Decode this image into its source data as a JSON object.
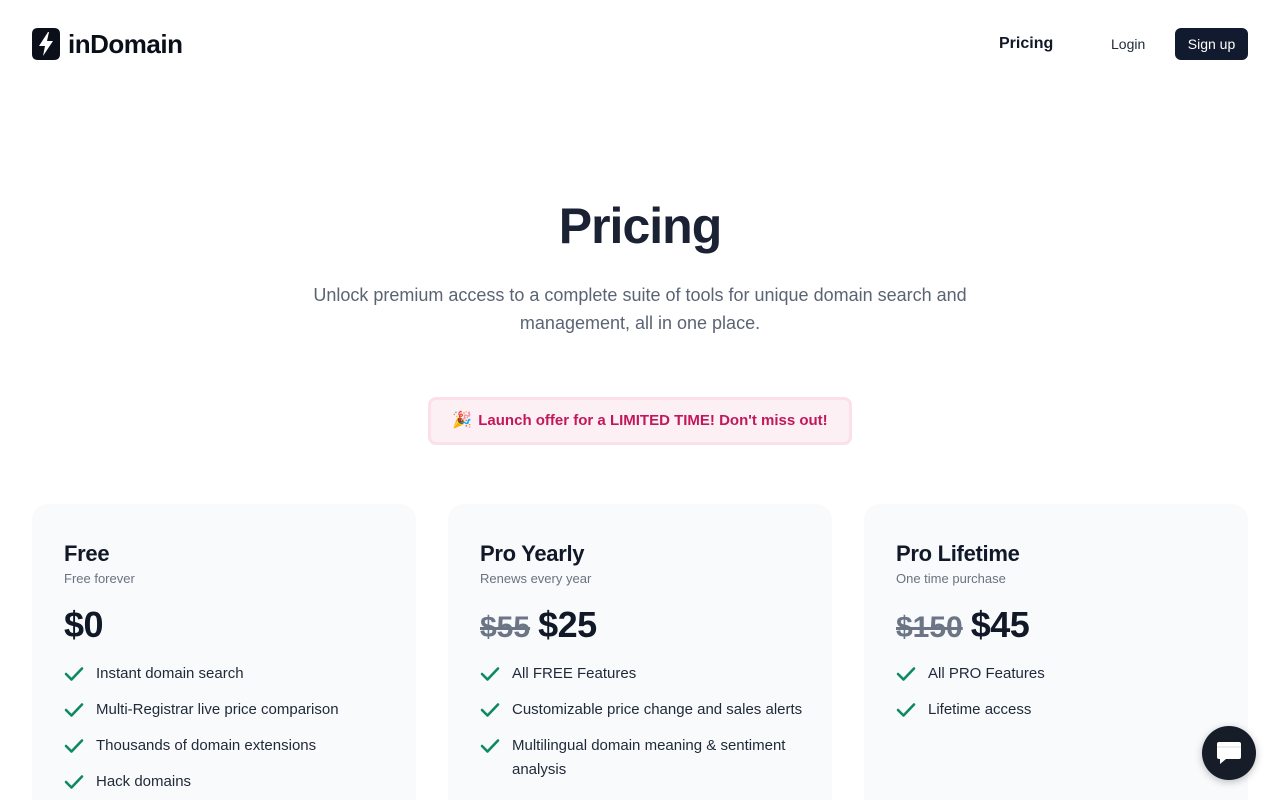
{
  "header": {
    "brand": "inDomain",
    "nav": {
      "pricing": "Pricing",
      "login": "Login",
      "signup": "Sign up"
    }
  },
  "hero": {
    "title": "Pricing",
    "subtitle": "Unlock premium access to a complete suite of tools for unique domain search and management, all in one place."
  },
  "offer": {
    "emoji": "🎉",
    "text": "Launch offer for a LIMITED TIME! Don't miss out!"
  },
  "plans": [
    {
      "name": "Free",
      "subtitle": "Free forever",
      "old_price": "",
      "price": "$0",
      "features": [
        "Instant domain search",
        "Multi-Registrar live price comparison",
        "Thousands of domain extensions",
        "Hack domains"
      ]
    },
    {
      "name": "Pro Yearly",
      "subtitle": "Renews every year",
      "old_price": "$55",
      "price": "$25",
      "features": [
        "All FREE Features",
        "Customizable price change and sales alerts",
        "Multilingual domain meaning & sentiment analysis"
      ]
    },
    {
      "name": "Pro Lifetime",
      "subtitle": "One time purchase",
      "old_price": "$150",
      "price": "$45",
      "features": [
        "All PRO Features",
        "Lifetime access"
      ]
    }
  ],
  "icons": {
    "logo": "lightning-bolt-icon",
    "feature": "check-icon",
    "chat": "chat-bubble-icon"
  },
  "colors": {
    "primary_button": "#111a2e",
    "check": "#0f8a5f",
    "offer_text": "#c2185b",
    "offer_bg": "#fdf0f4",
    "card_bg": "#f8fafc"
  }
}
